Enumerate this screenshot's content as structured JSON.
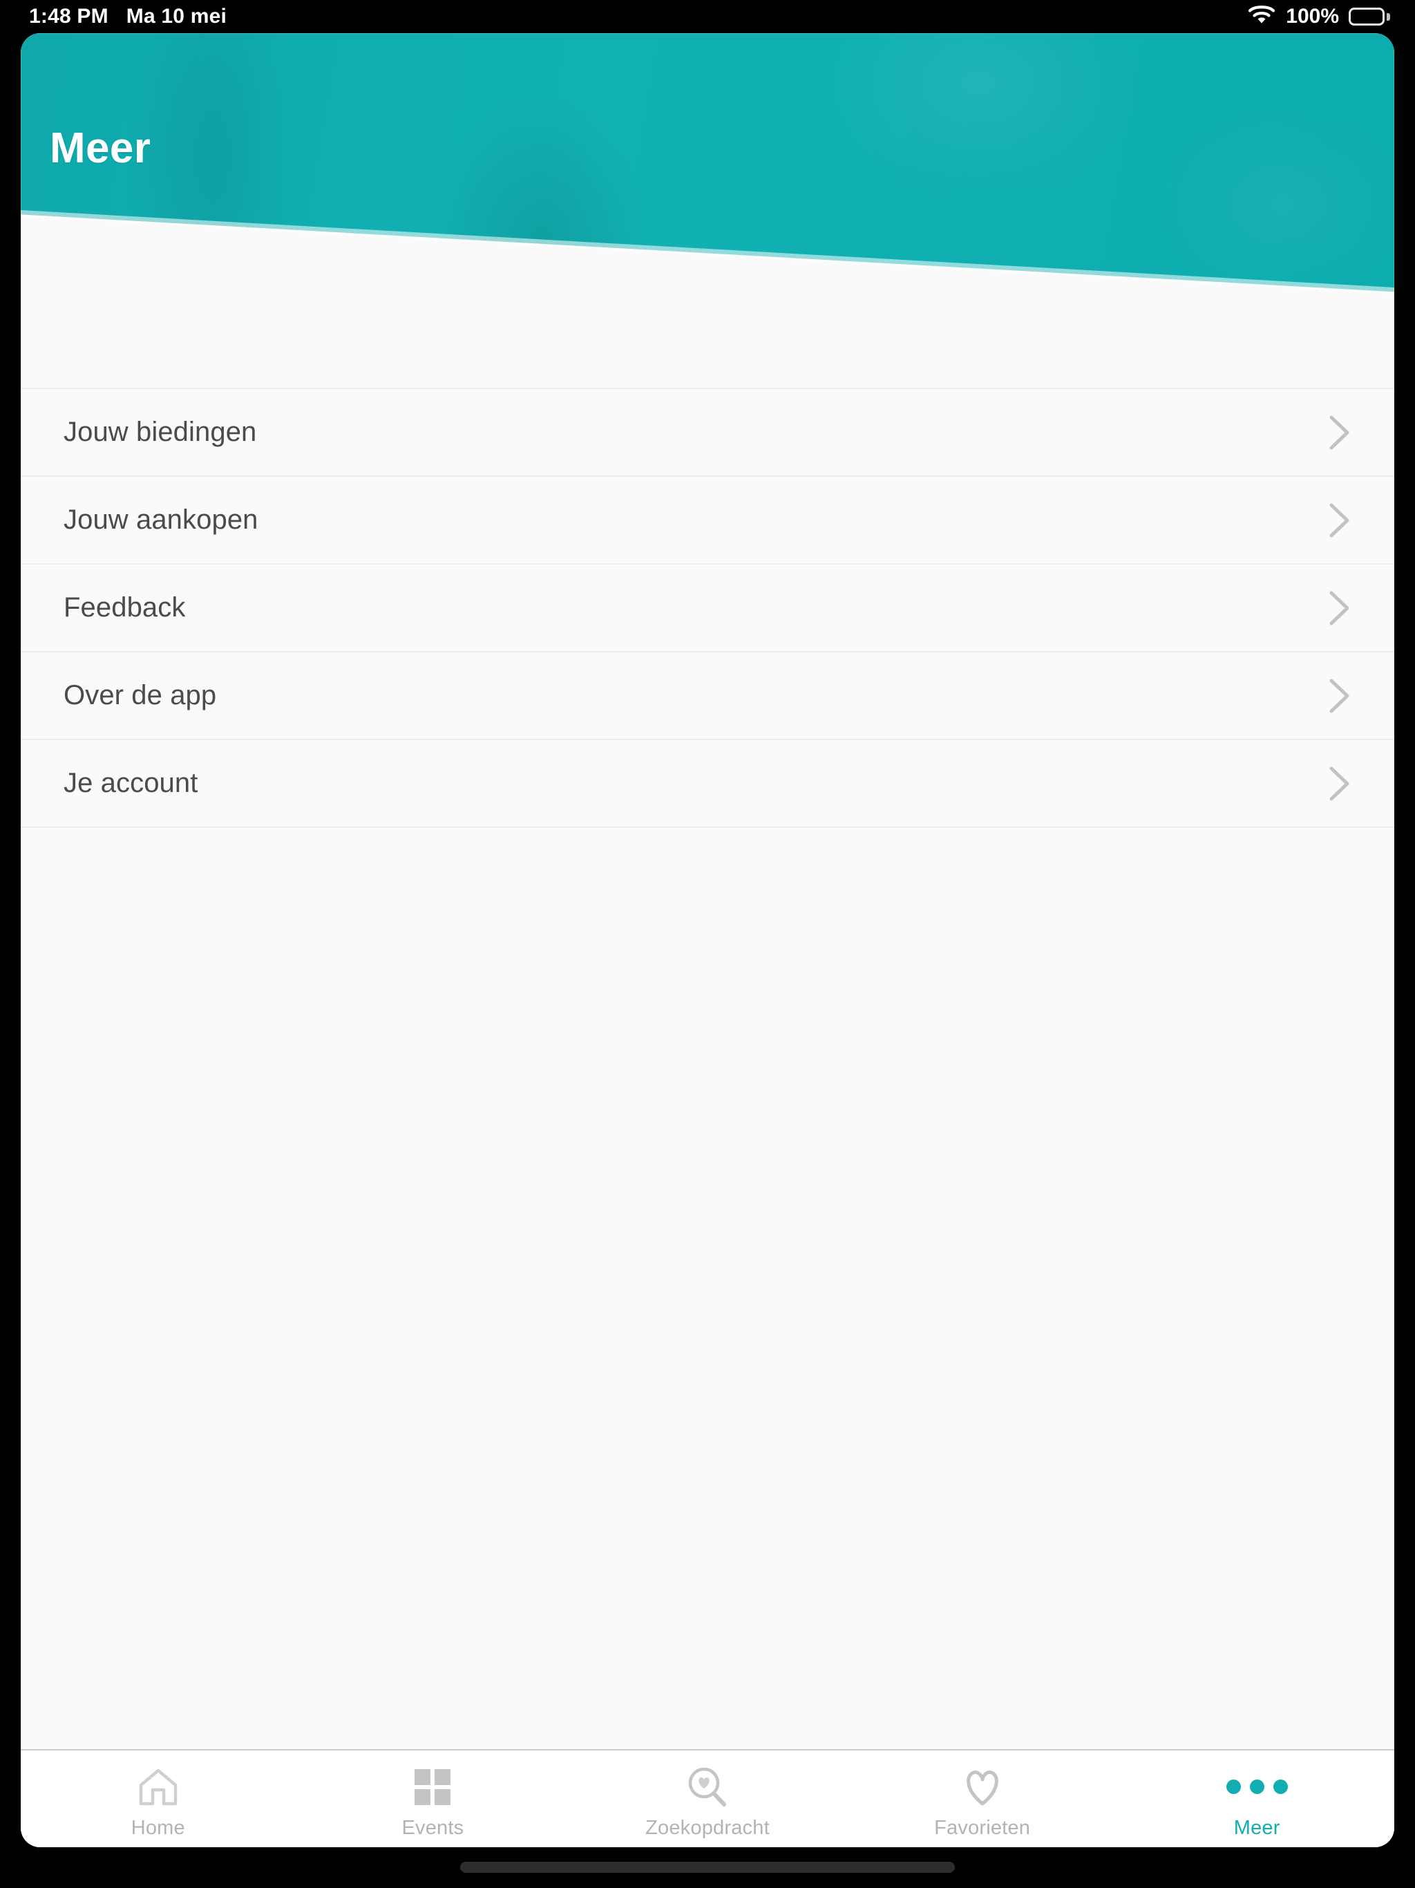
{
  "status_bar": {
    "time": "1:48 PM",
    "date": "Ma 10 mei",
    "battery_percent": "100%",
    "wifi_icon": "wifi-icon",
    "battery_icon": "battery-full-icon"
  },
  "header": {
    "title": "Meer",
    "background_color": "#10aeb1",
    "title_color": "#ffffff"
  },
  "colors": {
    "accent": "#10aeb1",
    "page_background": "#fafafa",
    "row_text": "#4b4b4b",
    "separator": "#ececec",
    "tab_inactive": "#b3b3b3"
  },
  "menu": {
    "items": [
      {
        "label": "Jouw biedingen",
        "chevron_icon": "chevron-right-icon"
      },
      {
        "label": "Jouw aankopen",
        "chevron_icon": "chevron-right-icon"
      },
      {
        "label": "Feedback",
        "chevron_icon": "chevron-right-icon"
      },
      {
        "label": "Over de app",
        "chevron_icon": "chevron-right-icon"
      },
      {
        "label": "Je account",
        "chevron_icon": "chevron-right-icon"
      }
    ]
  },
  "tab_bar": {
    "items": [
      {
        "label": "Home",
        "icon": "home-icon",
        "active": false
      },
      {
        "label": "Events",
        "icon": "grid-four-squares-icon",
        "active": false
      },
      {
        "label": "Zoekopdracht",
        "icon": "magnifier-heart-icon",
        "active": false
      },
      {
        "label": "Favorieten",
        "icon": "heart-outline-icon",
        "active": false
      },
      {
        "label": "Meer",
        "icon": "three-dots-icon",
        "active": true
      }
    ]
  }
}
